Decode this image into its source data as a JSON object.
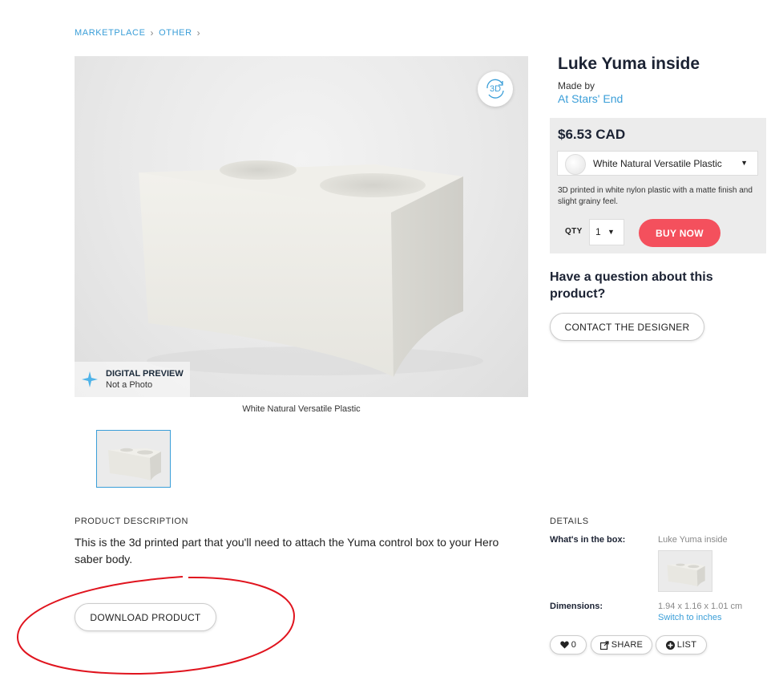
{
  "breadcrumb": {
    "items": [
      "MARKETPLACE",
      "OTHER"
    ]
  },
  "viewer": {
    "badge_title": "DIGITAL PREVIEW",
    "badge_subtitle": "Not a Photo",
    "caption": "White Natural Versatile Plastic",
    "view3d_icon": "3d-rotate-icon"
  },
  "product": {
    "title": "Luke Yuma inside",
    "made_by_label": "Made by",
    "designer": "At Stars' End"
  },
  "buy": {
    "price": "$6.53 CAD",
    "material": "White Natural Versatile Plastic",
    "material_description": "3D printed in white nylon plastic with a matte finish and slight grainy feel.",
    "qty_label": "QTY",
    "qty_value": "1",
    "buy_label": "BUY NOW"
  },
  "question": {
    "heading": "Have a question about this product?",
    "contact_label": "CONTACT THE DESIGNER"
  },
  "description": {
    "heading": "PRODUCT DESCRIPTION",
    "text": "This is the 3d printed part that you'll need to attach the Yuma control box to your Hero saber body.",
    "download_label": "DOWNLOAD PRODUCT"
  },
  "details": {
    "heading": "DETAILS",
    "box_label": "What's in the box:",
    "box_value": "Luke Yuma inside",
    "dims_label": "Dimensions:",
    "dims_value": "1.94 x 1.16 x 1.01 cm",
    "switch_label": "Switch to inches"
  },
  "social": {
    "like_count": "0",
    "share_label": "SHARE",
    "list_label": "LIST"
  },
  "colors": {
    "accent": "#3a9ed8",
    "buy_button": "#f4505d",
    "annotation": "#e0141e"
  }
}
